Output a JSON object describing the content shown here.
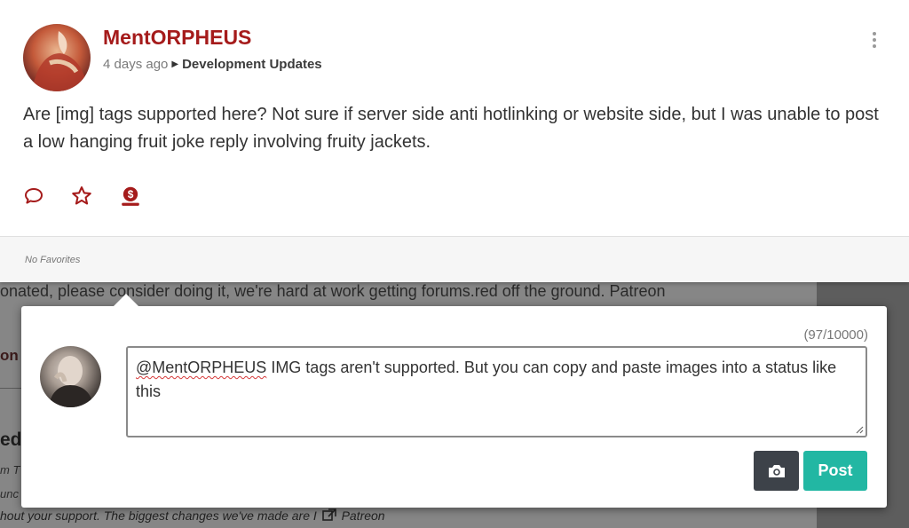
{
  "post": {
    "author": "MentORPHEUS",
    "time": "4 days ago",
    "category": "Development Updates",
    "body": "Are [img] tags supported here? Not sure if server side anti hotlinking or website side, but I was unable to post a low hanging fruit joke reply involving fruity jackets.",
    "favorites": "No Favorites",
    "icons": [
      "comment-icon",
      "star-icon",
      "tip-icon"
    ]
  },
  "background": {
    "line1": "onated, please consider doing it, we're hard at work getting forums.red off the ground. Patreon",
    "frag1": "on",
    "frag2": "ed",
    "frag3": "m T",
    "frag4": "unc",
    "line5": "hout your support. The biggest changes we've made are I",
    "line5_link": "Patreon"
  },
  "reply": {
    "counter": "(97/10000)",
    "mention": "@MentORPHEUS",
    "text": " IMG tags aren't supported. But you can copy and paste images into a status like this",
    "post_label": "Post"
  },
  "colors": {
    "author": "#a51b1b",
    "icons": "#a51b1b",
    "post_button": "#22b7a3",
    "camera_button": "#3d4249"
  }
}
